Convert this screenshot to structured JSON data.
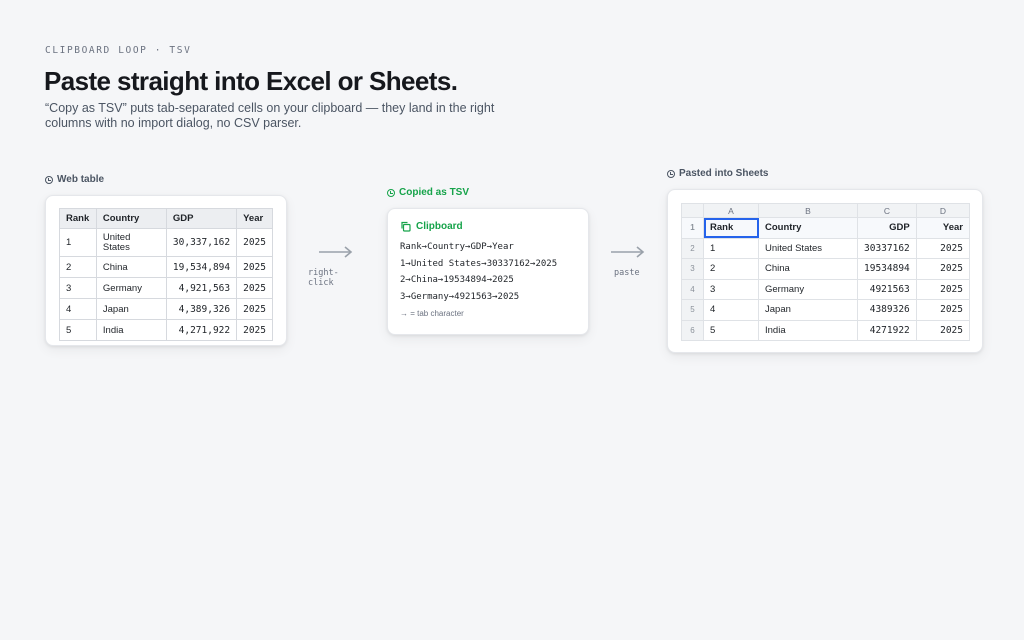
{
  "header": {
    "eyebrow": "CLIPBOARD LOOP · TSV",
    "title": "Paste straight into Excel or Sheets.",
    "subtitle": "“Copy as TSV” puts tab-separated cells on your clipboard — they land in the right columns with no import dialog, no CSV parser."
  },
  "web_table": {
    "label": "Web table",
    "columns": [
      "Rank",
      "Country",
      "GDP",
      "Year"
    ],
    "rows": [
      [
        "1",
        "United States",
        "30,337,162",
        "2025"
      ],
      [
        "2",
        "China",
        "19,534,894",
        "2025"
      ],
      [
        "3",
        "Germany",
        "4,921,563",
        "2025"
      ],
      [
        "4",
        "Japan",
        "4,389,326",
        "2025"
      ],
      [
        "5",
        "India",
        "4,271,922",
        "2025"
      ]
    ]
  },
  "arrow1": {
    "label_line1": "right-",
    "label_line2": "click"
  },
  "clipboard": {
    "section_label": "Copied as TSV",
    "title": "Clipboard",
    "lines": [
      "Rank→Country→GDP→Year",
      "1→United States→30337162→2025",
      "2→China→19534894→2025",
      "3→Germany→4921563→2025"
    ],
    "note": "→ = tab character"
  },
  "arrow2": {
    "label": "paste"
  },
  "sheets": {
    "label": "Pasted into Sheets",
    "col_letters": [
      "A",
      "B",
      "C",
      "D"
    ],
    "row_numbers": [
      "1",
      "2",
      "3",
      "4",
      "5",
      "6"
    ],
    "header": [
      "Rank",
      "Country",
      "GDP",
      "Year"
    ],
    "rows": [
      [
        "1",
        "United States",
        "30337162",
        "2025"
      ],
      [
        "2",
        "China",
        "19534894",
        "2025"
      ],
      [
        "3",
        "Germany",
        "4921563",
        "2025"
      ],
      [
        "4",
        "Japan",
        "4389326",
        "2025"
      ],
      [
        "5",
        "India",
        "4271922",
        "2025"
      ]
    ]
  },
  "colors": {
    "accent_green": "#16a34a",
    "selection_blue": "#2563eb"
  }
}
